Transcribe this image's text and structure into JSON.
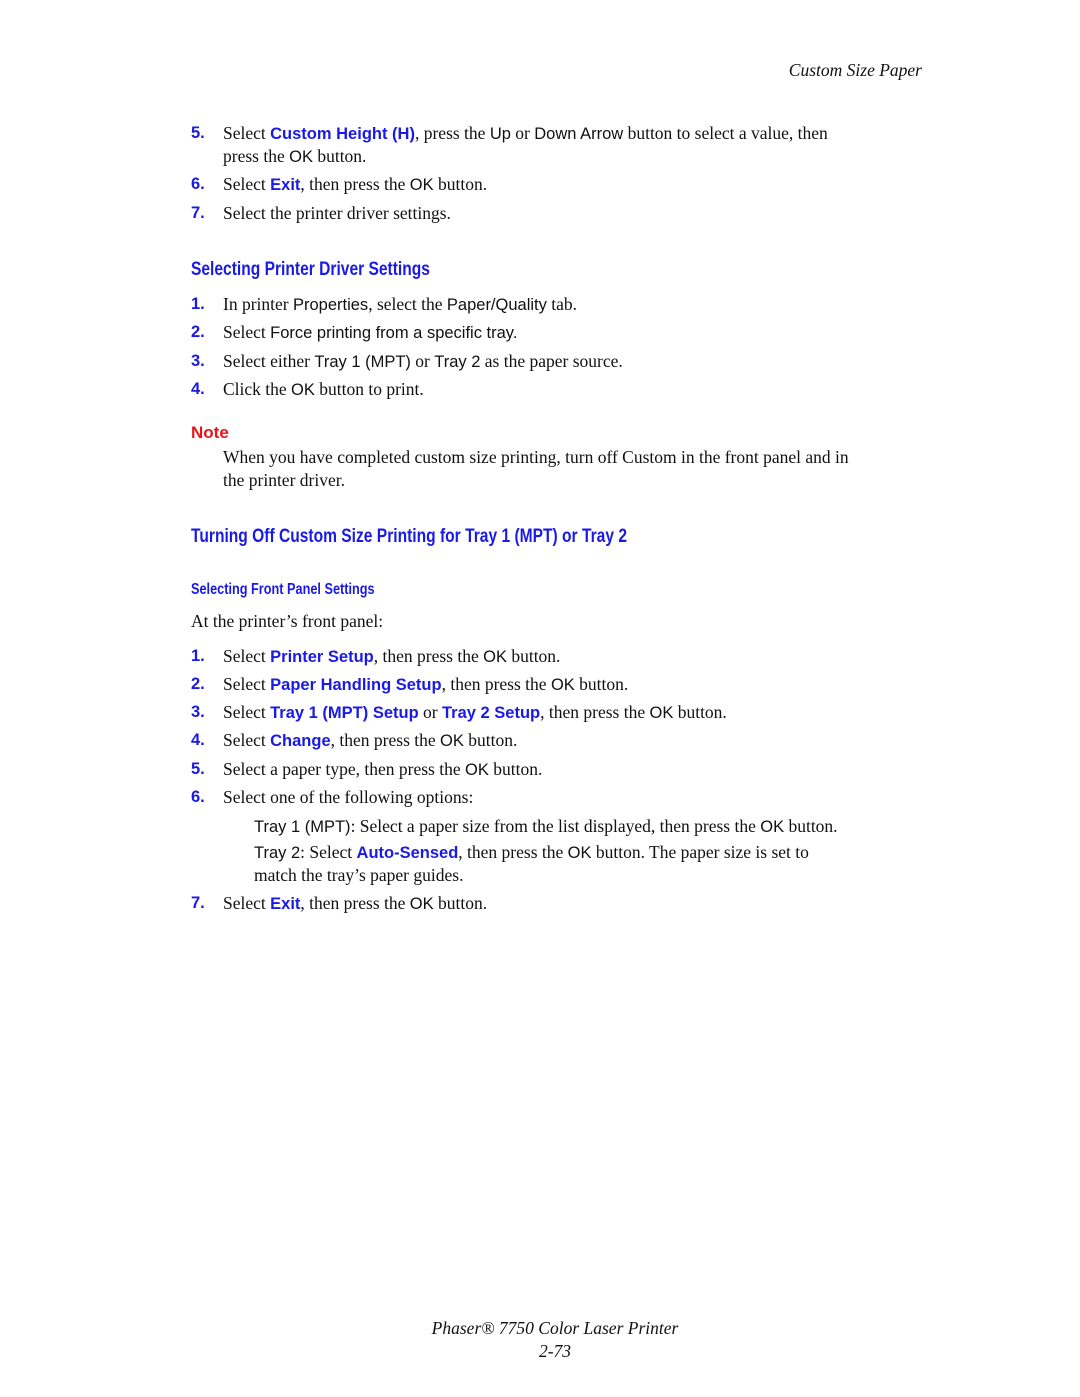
{
  "header": {
    "running_title": "Custom Size Paper"
  },
  "top_steps": [
    {
      "num": "5.",
      "pre": "Select ",
      "ui": "Custom Height (H)",
      "mid": ", press the ",
      "k1": "Up",
      "or": " or ",
      "k2": "Down Arrow",
      "post": "  button to select a value, then",
      "cont_pre": "press the ",
      "cont_key": "OK",
      "cont_post": "  button."
    },
    {
      "num": "6.",
      "pre": "Select ",
      "ui": "Exit",
      "mid": ", then press the ",
      "key": "OK",
      "post": "  button."
    },
    {
      "num": "7.",
      "text": "Select the printer driver settings."
    }
  ],
  "driver_section": {
    "heading": "Selecting Printer Driver Settings",
    "steps": [
      {
        "num": "1.",
        "pre": "In printer ",
        "k1": "Properties",
        "mid": ", select the ",
        "k2": "Paper/Quality",
        "post": " tab."
      },
      {
        "num": "2.",
        "pre": "Select ",
        "k1": "Force printing from a specific tray."
      },
      {
        "num": "3.",
        "pre": "Select either ",
        "k1": "Tray 1 (MPT)",
        "mid": "  or ",
        "k2": "Tray 2",
        "post": " as the paper source."
      },
      {
        "num": "4.",
        "pre": "Click the ",
        "k1": "OK",
        "post": "  button to print."
      }
    ]
  },
  "note": {
    "label": "Note",
    "line1": "When you have completed custom size printing, turn off Custom in the front panel and in",
    "line2": "the printer driver."
  },
  "turnoff_section": {
    "heading": "Turning Off Custom Size Printing for Tray 1 (MPT) or Tray 2",
    "subheading": "Selecting Front Panel Settings",
    "intro": "At the printer’s front panel:",
    "steps": [
      {
        "num": "1.",
        "pre": "Select ",
        "ui": "Printer Setup",
        "mid": ", then press the ",
        "key": "OK",
        "post": "  button."
      },
      {
        "num": "2.",
        "pre": "Select ",
        "ui": "Paper Handling Setup",
        "mid": ", then press the ",
        "key": "OK",
        "post": "  button."
      },
      {
        "num": "3.",
        "pre": "Select ",
        "ui": "Tray 1 (MPT) Setup",
        "or": " or ",
        "ui2": "Tray 2 Setup",
        "mid": ", then press the ",
        "key": "OK",
        "post": "  button."
      },
      {
        "num": "4.",
        "pre": "Select ",
        "ui": "Change",
        "mid": ", then press the ",
        "key": "OK",
        "post": "  button."
      },
      {
        "num": "5.",
        "pre": "Select a paper type, then press the ",
        "key": "OK",
        "post": "  button."
      },
      {
        "num": "6.",
        "text": "Select one of the following options:"
      },
      {
        "num": "7.",
        "pre": "Select ",
        "ui": "Exit",
        "mid": ", then press the ",
        "key": "OK",
        "post": "  button."
      }
    ],
    "options": {
      "tray1_label": "Tray 1 (MPT)",
      "tray1_text": ": Select a paper size from the list displayed, then press the ",
      "tray1_key": "OK",
      "tray1_post": "  button.",
      "tray2_label": "Tray 2",
      "tray2_pre": ": Select ",
      "tray2_ui": "Auto-Sensed",
      "tray2_mid": ", then press the ",
      "tray2_key": "OK",
      "tray2_post": "  button. The paper size is set to",
      "tray2_cont": "match the tray’s paper guides."
    }
  },
  "footer": {
    "product": "Phaser® 7750 Color Laser Printer",
    "page": "2-73"
  }
}
